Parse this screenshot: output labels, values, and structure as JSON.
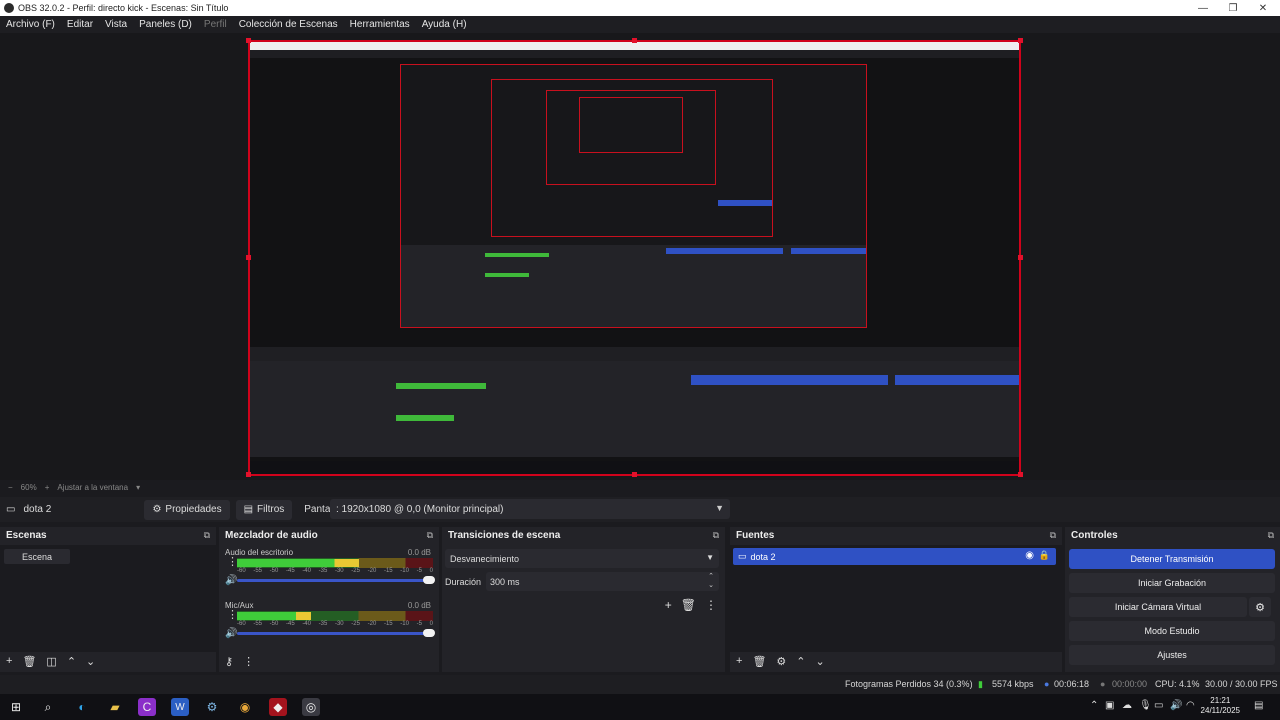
{
  "window": {
    "title": "OBS 32.0.2 - Perfil: directo kick - Escenas: Sin Título",
    "controls": [
      "—",
      "❐",
      "✕"
    ]
  },
  "menu": [
    {
      "label": "Archivo (F)",
      "enabled": true
    },
    {
      "label": "Editar",
      "enabled": true
    },
    {
      "label": "Vista",
      "enabled": true
    },
    {
      "label": "Paneles (D)",
      "enabled": true
    },
    {
      "label": "Perfil",
      "enabled": false
    },
    {
      "label": "Colección de Escenas",
      "enabled": true
    },
    {
      "label": "Herramientas",
      "enabled": true
    },
    {
      "label": "Ayuda (H)",
      "enabled": true
    }
  ],
  "preview": {
    "zoom_minus": "−",
    "zoom": "60%",
    "zoom_plus": "+",
    "fit_label": "Ajustar a la ventana"
  },
  "source_toolbar": {
    "source_name": "dota 2",
    "properties": "Propiedades",
    "filters": "Filtros",
    "display_label": "Pantalla",
    "display_value": ": 1920x1080 @ 0,0 (Monitor principal)"
  },
  "scenes": {
    "title": "Escenas",
    "items": [
      "Escena"
    ]
  },
  "mixer": {
    "title": "Mezclador de audio",
    "scale": [
      "-60",
      "-55",
      "-50",
      "-45",
      "-40",
      "-35",
      "-30",
      "-25",
      "-20",
      "-15",
      "-10",
      "-5",
      "0"
    ],
    "channels": [
      {
        "name": "Audio del escritorio",
        "db": "0.0 dB",
        "level": 0.62,
        "volume": 1.0
      },
      {
        "name": "Mic/Aux",
        "db": "0.0 dB",
        "level": 0.38,
        "volume": 1.0
      }
    ]
  },
  "transitions": {
    "title": "Transiciones de escena",
    "selected": "Desvanecimiento",
    "duration_label": "Duración",
    "duration_value": "300 ms"
  },
  "sources": {
    "title": "Fuentes",
    "items": [
      "dota 2"
    ]
  },
  "controls": {
    "title": "Controles",
    "stop_stream": "Detener Transmisión",
    "start_recording": "Iniciar Grabación",
    "start_virtualcam": "Iniciar Cámara Virtual",
    "studio_mode": "Modo Estudio",
    "settings": "Ajustes"
  },
  "status": {
    "dropped_frames": "Fotogramas Perdidos 34 (0.3%)",
    "bitrate": "5574 kbps",
    "stream_time": "00:06:18",
    "record_time": "00:00:00",
    "cpu": "CPU: 4.1%",
    "fps": "30.00 / 30.00 FPS"
  },
  "taskbar": {
    "time": "21:21",
    "date": "24/11/2025"
  },
  "colors": {
    "accent": "#2f51c4",
    "selection_red": "#d0021b",
    "meter_green": "#3fcc3a",
    "meter_yellow": "#e9c833"
  }
}
